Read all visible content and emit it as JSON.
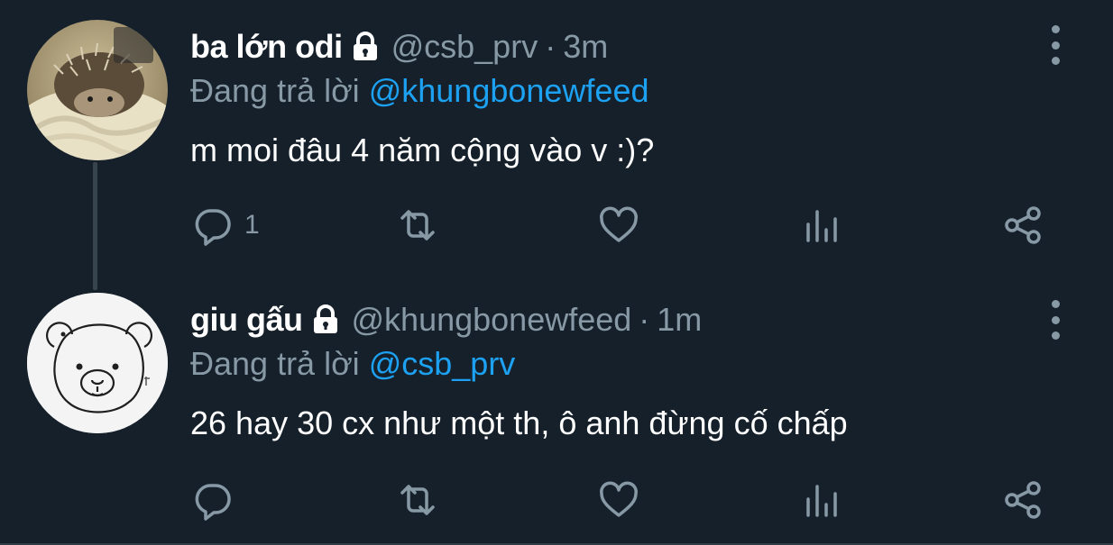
{
  "colors": {
    "background": "#15202b",
    "secondary_text": "#8899a6",
    "link": "#1da1f2",
    "primary_text": "#ffffff"
  },
  "tweets": [
    {
      "avatar_icon": "hedgehog-photo",
      "name": "ba lớn odi",
      "handle": "@csb_prv",
      "separator": "·",
      "time": "3m",
      "replying_prefix": "Đang trả lời",
      "replying_to": "@khungbonewfeed",
      "text": "m moi đâu 4 năm cộng vào v :)?",
      "reply_count": "1",
      "retweet_count": "",
      "like_count": ""
    },
    {
      "avatar_icon": "bear-drawing",
      "name": "giu gấu",
      "handle": "@khungbonewfeed",
      "separator": "·",
      "time": "1m",
      "replying_prefix": "Đang trả lời",
      "replying_to": "@csb_prv",
      "text": "26 hay 30 cx như một th, ô anh đừng cố chấp",
      "reply_count": "",
      "retweet_count": "",
      "like_count": ""
    }
  ]
}
